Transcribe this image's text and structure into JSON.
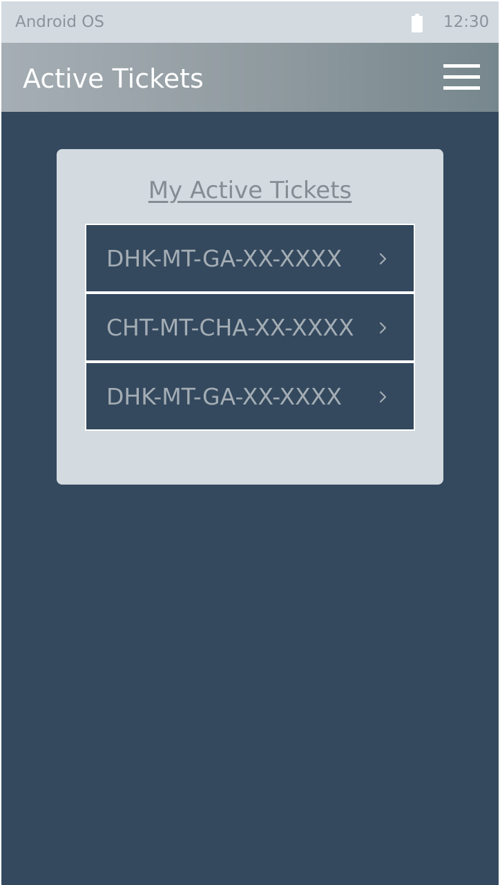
{
  "status_bar": {
    "os_label": "Android OS",
    "time": "12:30",
    "battery_icon": "battery-icon"
  },
  "app_bar": {
    "title": "Active Tickets",
    "menu_icon": "hamburger-menu-icon"
  },
  "card": {
    "title": "My Active Tickets",
    "tickets": [
      {
        "code": "DHK-MT-GA-XX-XXXX"
      },
      {
        "code": "CHT-MT-CHA-XX-XXXX"
      },
      {
        "code": "DHK-MT-GA-XX-XXXX"
      }
    ]
  },
  "colors": {
    "background": "#34495e",
    "card": "#d3dae0",
    "app_bar_start": "#a5aeb4",
    "app_bar_end": "#76878d",
    "ticket_text": "#a4adb4"
  }
}
